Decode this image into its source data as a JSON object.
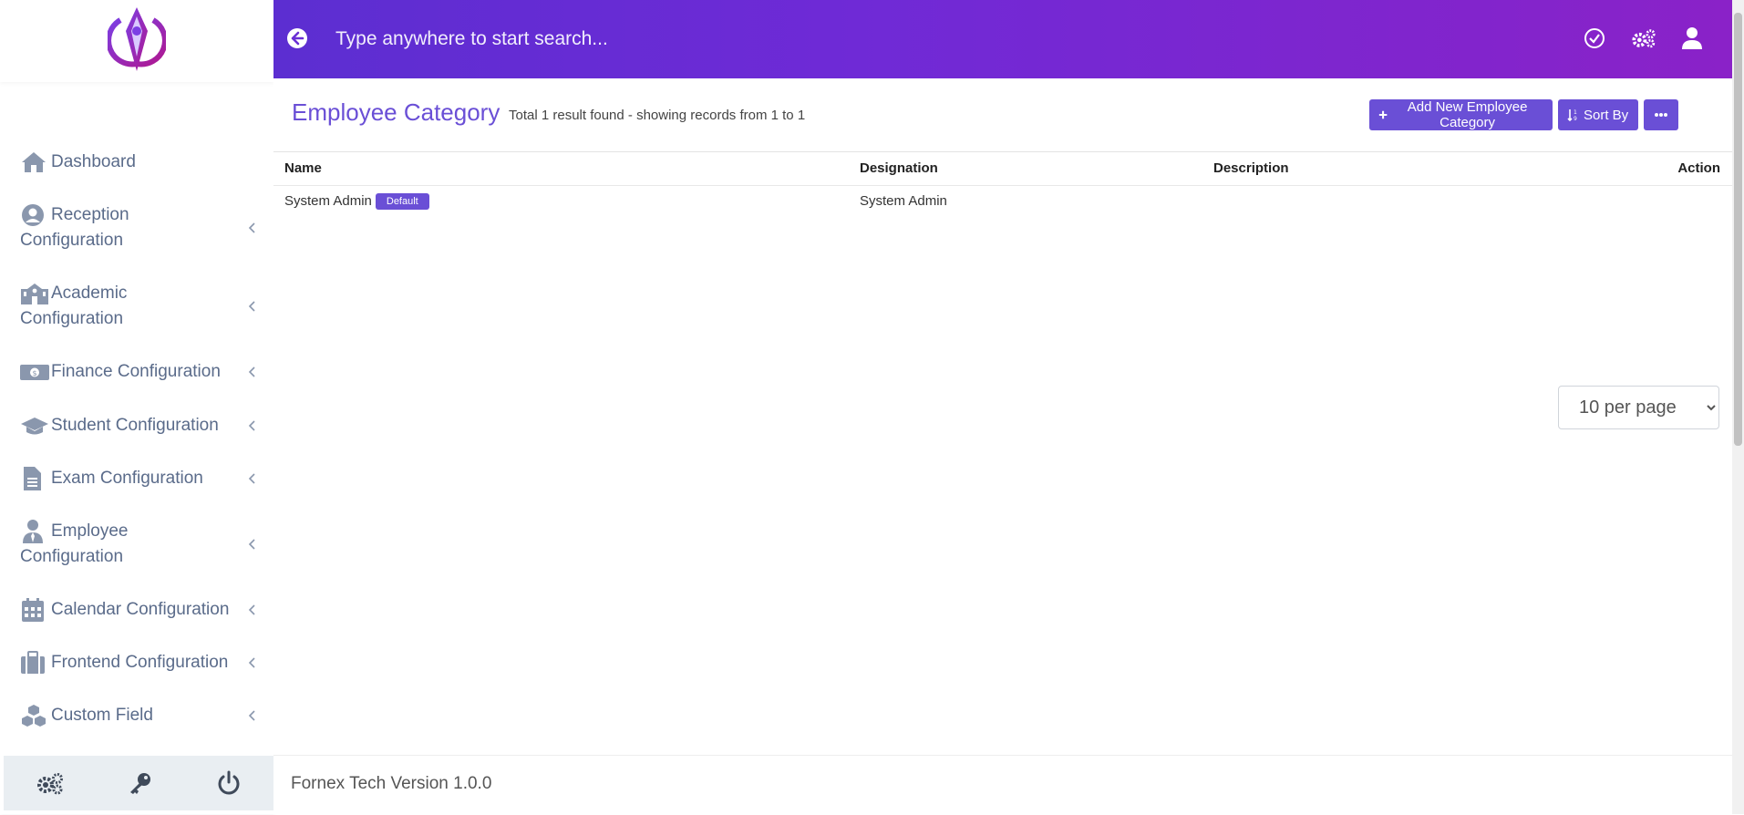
{
  "header": {
    "search_placeholder": "Type anywhere to start search..."
  },
  "sidebar": {
    "items": [
      {
        "label": "Dashboard",
        "icon": "home-icon",
        "has_chevron": false
      },
      {
        "label": "Reception",
        "label2": "Configuration",
        "icon": "user-circle-icon",
        "has_chevron": true
      },
      {
        "label": "Academic",
        "label2": "Configuration",
        "icon": "school-icon",
        "has_chevron": true
      },
      {
        "label": "Finance Configuration",
        "icon": "money-icon",
        "has_chevron": true
      },
      {
        "label": "Student Configuration",
        "icon": "graduation-cap-icon",
        "has_chevron": true
      },
      {
        "label": "Exam Configuration",
        "icon": "file-icon",
        "has_chevron": true
      },
      {
        "label": "Employee",
        "label2": "Configuration",
        "icon": "user-tie-icon",
        "has_chevron": true
      },
      {
        "label": "Calendar Configuration",
        "icon": "calendar-icon",
        "has_chevron": true
      },
      {
        "label": "Frontend Configuration",
        "icon": "briefcase-icon",
        "has_chevron": true
      },
      {
        "label": "Custom Field",
        "icon": "cubes-icon",
        "has_chevron": true
      }
    ]
  },
  "main": {
    "title": "Employee Category",
    "subtitle": "Total 1 result found - showing records from 1 to 1",
    "buttons": {
      "add": "Add New Employee Category",
      "sort": "Sort By"
    },
    "table": {
      "columns": [
        "Name",
        "Designation",
        "Description",
        "Action"
      ],
      "rows": [
        {
          "name": "System Admin",
          "badge": "Default",
          "designation": "System Admin",
          "description": ""
        }
      ]
    },
    "per_page": "10 per page",
    "footer": "Fornex Tech Version 1.0.0"
  },
  "colors": {
    "accent": "#6a4fd6",
    "header_start": "#5c2ed1",
    "header_end": "#8a22c8",
    "sidebar_text": "#5a6b8a"
  }
}
